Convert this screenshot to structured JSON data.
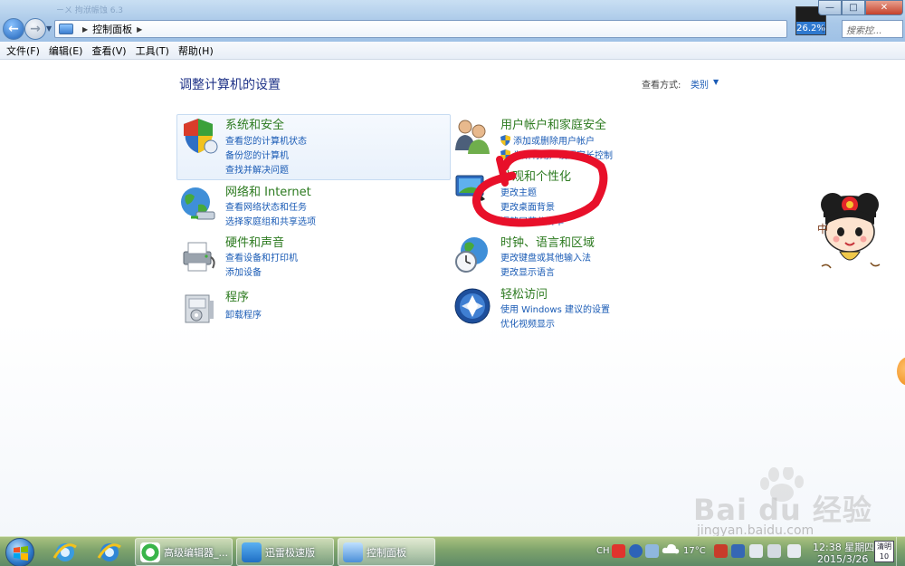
{
  "window": {
    "ghost_title": "ㄧㄨ 拘洑帪蚀 6.3",
    "breadcrumb": [
      "控制面板"
    ],
    "search_placeholder": "搜索控...",
    "memory_badge": "26.2%"
  },
  "menu": [
    "文件(F)",
    "编辑(E)",
    "查看(V)",
    "工具(T)",
    "帮助(H)"
  ],
  "page": {
    "heading": "调整计算机的设置",
    "view_label": "查看方式:",
    "view_value": "类别"
  },
  "categories": {
    "system": {
      "title": "系统和安全",
      "links": [
        "查看您的计算机状态",
        "备份您的计算机",
        "查找并解决问题"
      ]
    },
    "network": {
      "title": "网络和 Internet",
      "links": [
        "查看网络状态和任务",
        "选择家庭组和共享选项"
      ]
    },
    "hardware": {
      "title": "硬件和声音",
      "links": [
        "查看设备和打印机",
        "添加设备"
      ]
    },
    "programs": {
      "title": "程序",
      "links": [
        "卸载程序"
      ]
    },
    "users": {
      "title": "用户帐户和家庭安全",
      "links": [
        "添加或删除用户帐户",
        "为所有用户设置家长控制"
      ]
    },
    "appearance": {
      "title": "外观和个性化",
      "links": [
        "更改主题",
        "更改桌面背景",
        "调整屏幕分辨率"
      ]
    },
    "clock": {
      "title": "时钟、语言和区域",
      "links": [
        "更改键盘或其他输入法",
        "更改显示语言"
      ]
    },
    "ease": {
      "title": "轻松访问",
      "links": [
        "使用 Windows 建议的设置",
        "优化视频显示"
      ]
    }
  },
  "sticker_text": "中",
  "watermark": {
    "brand": "Bai du 经验",
    "url": "jingyan.baidu.com"
  },
  "taskbar": {
    "tasks": [
      "高级编辑器_...",
      "迅雷极速版",
      "控制面板"
    ],
    "tray": {
      "lang": "CH",
      "temperature": "17°C",
      "time": "12:38 星期四",
      "date": "2015/3/26",
      "weather_chip": [
        "清明",
        "10"
      ]
    }
  },
  "colors": {
    "category_title": "#2c7a1f",
    "link": "#1a5bb5",
    "scribble": "#e8102a"
  }
}
